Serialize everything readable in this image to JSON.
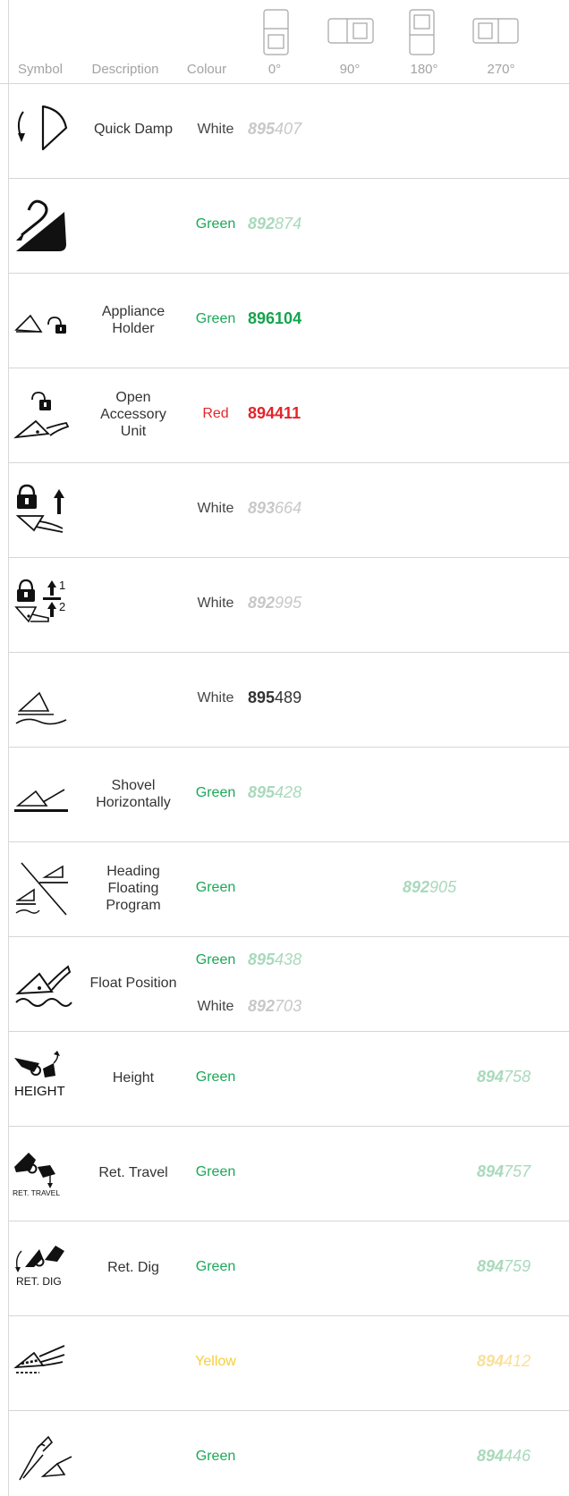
{
  "header": {
    "symbol": "Symbol",
    "description": "Description",
    "colour": "Colour",
    "deg0": "0°",
    "deg90": "90°",
    "deg180": "180°",
    "deg270": "270°"
  },
  "rows": [
    {
      "desc": "Quick Damp",
      "colour": "White",
      "prefix": "895",
      "suffix": "407"
    },
    {
      "desc": "",
      "colour": "Green",
      "prefix": "892",
      "suffix": "874"
    },
    {
      "desc_lines": [
        "Appliance",
        "Holder"
      ],
      "colour": "Green",
      "prefix": "896",
      "suffix": "104"
    },
    {
      "desc_lines": [
        "Open",
        "Accessory",
        "Unit"
      ],
      "colour": "Red",
      "prefix": "894",
      "suffix": "411"
    },
    {
      "desc": "",
      "colour": "White",
      "prefix": "893",
      "suffix": "664"
    },
    {
      "desc": "",
      "colour": "White",
      "prefix": "892",
      "suffix": "995",
      "sym_n1": "1",
      "sym_n2": "2"
    },
    {
      "desc": "",
      "colour": "White",
      "prefix": "895",
      "suffix": "489"
    },
    {
      "desc_lines": [
        "Shovel",
        "Horizontally"
      ],
      "colour": "Green",
      "prefix": "895",
      "suffix": "428"
    },
    {
      "desc_lines": [
        "Heading",
        "Floating",
        "Program"
      ],
      "colour": "Green",
      "prefix": "892",
      "suffix": "905"
    },
    {
      "desc": "Float Position",
      "colour": "Green",
      "prefix": "895",
      "suffix": "438",
      "colour2": "White",
      "prefix2": "892",
      "suffix2": "703"
    },
    {
      "desc": "Height",
      "colour": "Green",
      "prefix": "894",
      "suffix": "758",
      "sym_text": "HEIGHT"
    },
    {
      "desc": "Ret. Travel",
      "colour": "Green",
      "prefix": "894",
      "suffix": "757",
      "sym_text": "RET. TRAVEL"
    },
    {
      "desc": "Ret. Dig",
      "colour": "Green",
      "prefix": "894",
      "suffix": "759",
      "sym_text": "RET. DIG"
    },
    {
      "desc": "",
      "colour": "Yellow",
      "prefix": "894",
      "suffix": "412"
    },
    {
      "desc": "",
      "colour": "Green",
      "prefix": "894",
      "suffix": "446"
    }
  ]
}
